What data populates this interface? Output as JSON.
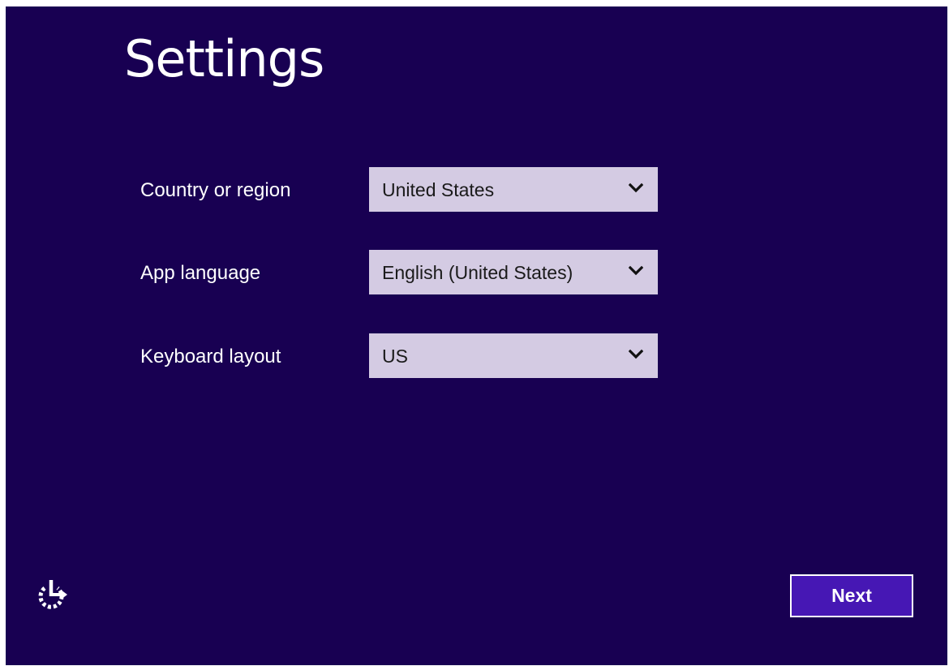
{
  "page": {
    "title": "Settings",
    "background_color": "#180052",
    "accent_color": "#4617b4",
    "dropdown_color": "#d4cbe3"
  },
  "form": {
    "country": {
      "label": "Country or region",
      "value": "United States",
      "icon": "chevron-down-icon"
    },
    "app_language": {
      "label": "App language",
      "value": "English (United States)",
      "icon": "chevron-down-icon"
    },
    "keyboard": {
      "label": "Keyboard layout",
      "value": "US",
      "icon": "chevron-down-icon"
    }
  },
  "footer": {
    "ease_of_access_icon": "ease-of-access-icon",
    "next_label": "Next"
  }
}
